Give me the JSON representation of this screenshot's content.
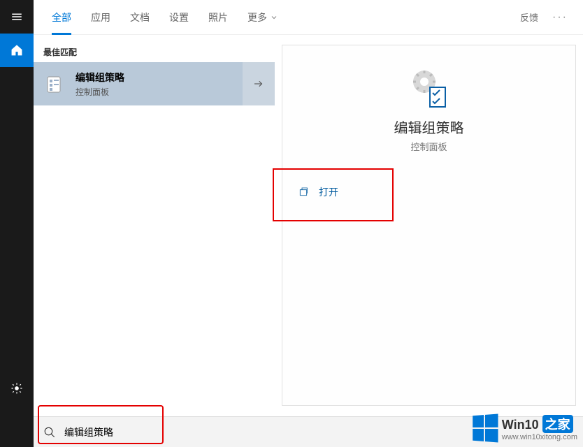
{
  "sidebar": {
    "icons": [
      "hamburger",
      "home",
      "settings"
    ]
  },
  "tabs": {
    "items": [
      "全部",
      "应用",
      "文档",
      "设置",
      "照片"
    ],
    "more": "更多",
    "active_index": 0,
    "feedback": "反馈"
  },
  "results": {
    "section_header": "最佳匹配",
    "item": {
      "title": "编辑组策略",
      "subtitle": "控制面板"
    }
  },
  "details": {
    "title": "编辑组策略",
    "subtitle": "控制面板",
    "actions": {
      "open": "打开"
    }
  },
  "search": {
    "value": "编辑组策略"
  },
  "watermark": {
    "line1_a": "Win10",
    "line1_b": "之家",
    "line2": "www.win10xitong.com"
  }
}
